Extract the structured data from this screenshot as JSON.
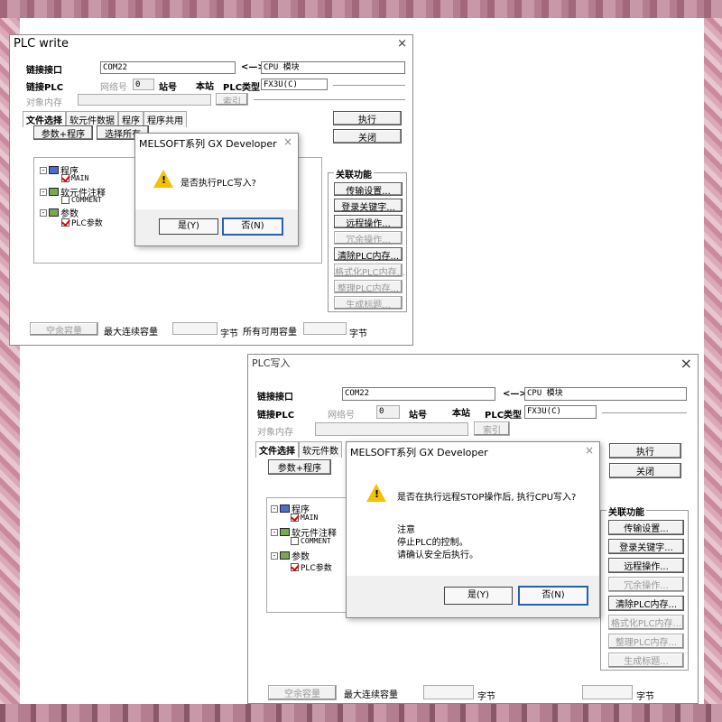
{
  "window1": {
    "title": "PLC write",
    "close": "×",
    "link_label": "链接接口",
    "link_value": "COM22",
    "arrow": "<—>",
    "cpu_value": "CPU 模块",
    "link_plc_label": "链接PLC",
    "network_label": "网络号",
    "network_value": "0",
    "station_label": "站号",
    "station_value": "本站",
    "plc_type_label": "PLC类型",
    "plc_type_value": "FX3U(C)",
    "target_memory_label": "对象内存",
    "index_button": "索引",
    "tabs": [
      "文件选择",
      "软元件数据",
      "程序",
      "程序共用"
    ],
    "param_program_button": "参数+程序",
    "select_all_button": "选择所有",
    "execute_button": "执行",
    "close_button": "关闭",
    "related_title": "关联功能",
    "related_buttons": [
      "传输设置...",
      "登录关键字...",
      "远程操作...",
      "冗余操作...",
      "清除PLC内存...",
      "格式化PLC内存...",
      "整理PLC内存...",
      "生成标题..."
    ],
    "tree": {
      "program": "程序",
      "main": "MAIN",
      "device_comment": "软元件注释",
      "comment": "COMMENT",
      "parameter": "参数",
      "plc_param": "PLC参数"
    },
    "free_capacity_button": "空余容量",
    "max_continuous_label": "最大连续容量",
    "bytes1": "字节",
    "all_available_label": "所有可用容量",
    "bytes2": "字节",
    "dialog": {
      "title": "MELSOFT系列 GX Developer",
      "close": "×",
      "message": "是否执行PLC写入?",
      "yes": "是(Y)",
      "no": "否(N)"
    }
  },
  "window2": {
    "title": "PLC写入",
    "close": "×",
    "link_label": "链接接口",
    "link_value": "COM22",
    "arrow": "<—>",
    "cpu_value": "CPU 模块",
    "link_plc_label": "链接PLC",
    "network_label": "网络号",
    "network_value": "0",
    "station_label": "站号",
    "station_value": "本站",
    "plc_type_label": "PLC类型",
    "plc_type_value": "FX3U(C)",
    "target_memory_label": "对象内存",
    "index_button": "索引",
    "tabs": [
      "文件选择",
      "软元件数"
    ],
    "param_program_button": "参数+程序",
    "execute_button": "执行",
    "close_button": "关闭",
    "related_title": "关联功能",
    "related_buttons": [
      "传输设置...",
      "登录关键字...",
      "远程操作...",
      "冗余操作...",
      "清除PLC内存...",
      "格式化PLC内存...",
      "整理PLC内存...",
      "生成标题..."
    ],
    "tree": {
      "program": "程序",
      "main": "MAIN",
      "device_comment": "软元件注释",
      "comment": "COMMENT",
      "parameter": "参数",
      "plc_param": "PLC参数"
    },
    "free_capacity_button": "空余容量",
    "max_continuous_label": "最大连续容量",
    "bytes1": "字节",
    "bytes2": "字节",
    "dialog": {
      "title": "MELSOFT系列 GX Developer",
      "close": "×",
      "message": "是否在执行远程STOP操作后, 执行CPU写入?",
      "note_title": "注意",
      "note_line1": "停止PLC的控制。",
      "note_line2": "请确认安全后执行。",
      "yes": "是(Y)",
      "no": "否(N)"
    }
  },
  "colors": {
    "warning": "#f2c200",
    "check": "#dd0000",
    "folder": "#4b6fc8",
    "focus": "#2a5fb0"
  }
}
